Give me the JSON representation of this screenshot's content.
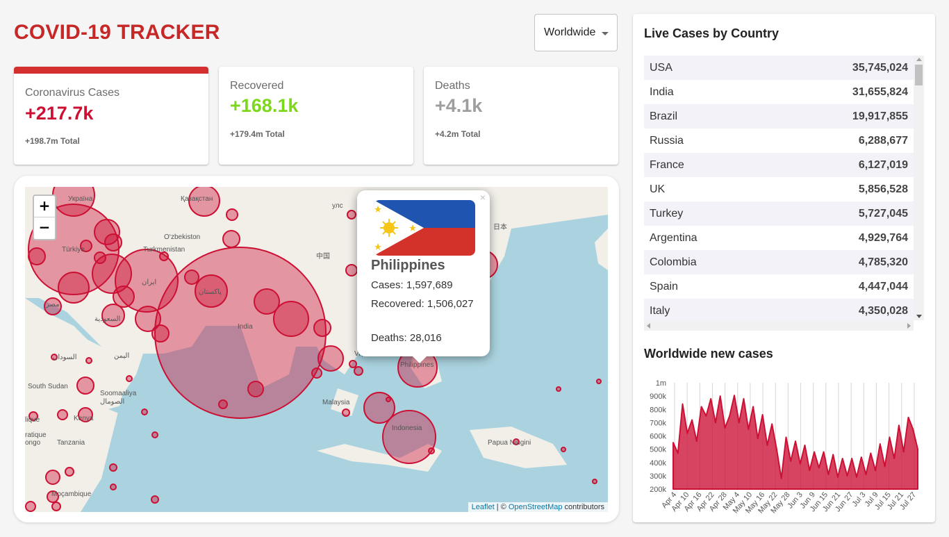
{
  "header": {
    "title": "COVID-19 TRACKER",
    "country_select": "Worldwide"
  },
  "stats": [
    {
      "label": "Coronavirus Cases",
      "value": "+217.7k",
      "total": "+198.7m Total",
      "color": "#cc1034",
      "selected": true
    },
    {
      "label": "Recovered",
      "value": "+168.1k",
      "total": "+179.4m Total",
      "color": "#7dd71d",
      "selected": false
    },
    {
      "label": "Deaths",
      "value": "+4.1k",
      "total": "+4.2m Total",
      "color": "#9e9e9e",
      "selected": false
    }
  ],
  "map": {
    "zoom_in": "+",
    "zoom_out": "−",
    "attribution": {
      "leaflet": "Leaflet",
      "sep": " | © ",
      "osm": "OpenStreetMap",
      "suffix": " contributors"
    },
    "circle_color": "#cc1034",
    "labels": [
      "Україна",
      "Қазақстан",
      "O‘zbekiston",
      "Türkiye",
      "Turkmenistan",
      "ایران",
      "پاکستان",
      "India",
      "中国",
      "日本",
      "Philippines",
      "Malaysia",
      "Indonesia",
      "Papua Niugini",
      "South Sudan",
      "Soomaaliya",
      "الصومال",
      "Kenya",
      "Tanzania",
      "Moçambique",
      "مصر",
      "السعودية",
      "اليمن",
      "السودان",
      "ongo",
      "ratique",
      "lique",
      "улс",
      "Việt Nam"
    ],
    "popup": {
      "close": "×",
      "country": "Philippines",
      "cases": "Cases: 1,597,689",
      "recovered": "Recovered: 1,506,027",
      "deaths": "Deaths: 28,016",
      "flag": "philippines-flag"
    }
  },
  "sidebar": {
    "table_title": "Live Cases by Country",
    "countries": [
      {
        "name": "USA",
        "cases": "35,745,024"
      },
      {
        "name": "India",
        "cases": "31,655,824"
      },
      {
        "name": "Brazil",
        "cases": "19,917,855"
      },
      {
        "name": "Russia",
        "cases": "6,288,677"
      },
      {
        "name": "France",
        "cases": "6,127,019"
      },
      {
        "name": "UK",
        "cases": "5,856,528"
      },
      {
        "name": "Turkey",
        "cases": "5,727,045"
      },
      {
        "name": "Argentina",
        "cases": "4,929,764"
      },
      {
        "name": "Colombia",
        "cases": "4,785,320"
      },
      {
        "name": "Spain",
        "cases": "4,447,044"
      },
      {
        "name": "Italy",
        "cases": "4,350,028"
      }
    ],
    "chart_title": "Worldwide new cases"
  },
  "chart_data": {
    "type": "area",
    "title": "Worldwide new cases",
    "xlabel": "",
    "ylabel": "",
    "color": "#cc1034",
    "ylim": [
      200000,
      1000000
    ],
    "yticks": [
      "200k",
      "300k",
      "400k",
      "500k",
      "600k",
      "700k",
      "800k",
      "900k",
      "1m"
    ],
    "ytick_values": [
      200000,
      300000,
      400000,
      500000,
      600000,
      700000,
      800000,
      900000,
      1000000
    ],
    "xticks": [
      "Apr 4",
      "Apr 10",
      "Apr 16",
      "Apr 22",
      "Apr 28",
      "May 4",
      "May 10",
      "May 16",
      "May 22",
      "May 28",
      "Jun 3",
      "Jun 9",
      "Jun 15",
      "Jun 21",
      "Jun 27",
      "Jul 3",
      "Jul 9",
      "Jul 15",
      "Jul 21",
      "Jul 27"
    ],
    "grid": true,
    "x": [
      "Apr 1",
      "Apr 4",
      "Apr 7",
      "Apr 8",
      "Apr 10",
      "Apr 12",
      "Apr 13",
      "Apr 16",
      "Apr 18",
      "Apr 20",
      "Apr 22",
      "Apr 24",
      "Apr 25",
      "Apr 27",
      "Apr 30",
      "May 2",
      "May 4",
      "May 6",
      "May 8",
      "May 10",
      "May 12",
      "May 14",
      "May 16",
      "May 17",
      "May 18",
      "May 19",
      "May 20",
      "May 22",
      "May 24",
      "May 26",
      "May 28",
      "May 31",
      "Jun 3",
      "Jun 6",
      "Jun 9",
      "Jun 12",
      "Jun 15",
      "Jun 18",
      "Jun 21",
      "Jun 24",
      "Jun 27",
      "Jun 30",
      "Jul 3",
      "Jul 6",
      "Jul 9",
      "Jul 12",
      "Jul 15",
      "Jul 18",
      "Jul 21",
      "Jul 24",
      "Jul 27",
      "Jul 29",
      "Jul 30"
    ],
    "values": [
      550000,
      470000,
      840000,
      620000,
      720000,
      560000,
      820000,
      750000,
      880000,
      700000,
      900000,
      660000,
      750000,
      905000,
      700000,
      880000,
      650000,
      820000,
      580000,
      760000,
      530000,
      690000,
      500000,
      280000,
      590000,
      410000,
      560000,
      390000,
      530000,
      340000,
      480000,
      360000,
      480000,
      310000,
      460000,
      290000,
      430000,
      300000,
      430000,
      290000,
      440000,
      310000,
      470000,
      340000,
      540000,
      370000,
      590000,
      430000,
      680000,
      480000,
      740000,
      650000,
      500000
    ]
  }
}
